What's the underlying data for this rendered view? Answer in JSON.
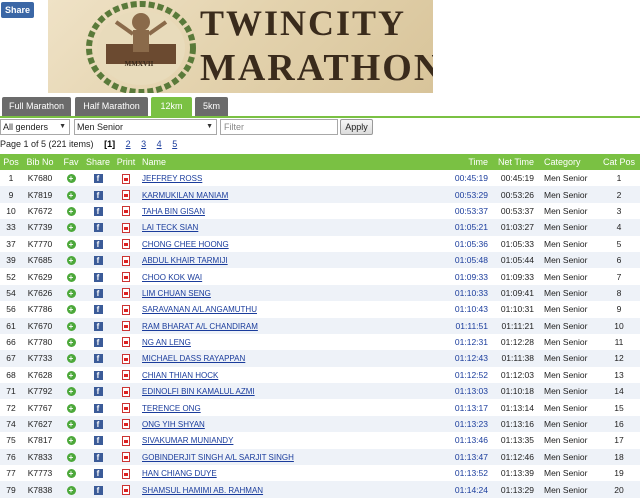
{
  "share_label": "Share",
  "banner": {
    "emblem_text": "MMXVII",
    "title_line1": "TWINCITY",
    "title_line2": "MARATHON"
  },
  "tabs": [
    {
      "label": "Full Marathon",
      "active": false
    },
    {
      "label": "Half Marathon",
      "active": false
    },
    {
      "label": "12km",
      "active": true
    },
    {
      "label": "5km",
      "active": false
    }
  ],
  "filters": {
    "gender_selected": "All genders",
    "category_selected": "Men Senior",
    "filter_placeholder": "Filter",
    "apply_label": "Apply"
  },
  "pager": {
    "summary": "Page 1 of 5 (221 items)",
    "current": "[1]",
    "pages": [
      "2",
      "3",
      "4",
      "5"
    ]
  },
  "columns": [
    "Pos",
    "Bib No",
    "Fav",
    "Share",
    "Print",
    "Name",
    "Time",
    "Net Time",
    "Category",
    "Cat Pos"
  ],
  "rows": [
    {
      "pos": "1",
      "bib": "K7680",
      "name": "JEFFREY ROSS",
      "time": "00:45:19",
      "net": "00:45:19",
      "cat": "Men Senior",
      "catpos": "1"
    },
    {
      "pos": "9",
      "bib": "K7819",
      "name": "KARMUKILAN MANIAM",
      "time": "00:53:29",
      "net": "00:53:26",
      "cat": "Men Senior",
      "catpos": "2"
    },
    {
      "pos": "10",
      "bib": "K7672",
      "name": "TAHA BIN GISAN",
      "time": "00:53:37",
      "net": "00:53:37",
      "cat": "Men Senior",
      "catpos": "3"
    },
    {
      "pos": "33",
      "bib": "K7739",
      "name": "LAI TECK SIAN",
      "time": "01:05:21",
      "net": "01:03:27",
      "cat": "Men Senior",
      "catpos": "4"
    },
    {
      "pos": "37",
      "bib": "K7770",
      "name": "CHONG CHEE HOONG",
      "time": "01:05:36",
      "net": "01:05:33",
      "cat": "Men Senior",
      "catpos": "5"
    },
    {
      "pos": "39",
      "bib": "K7685",
      "name": "ABDUL KHAIR TARMIJI",
      "time": "01:05:48",
      "net": "01:05:44",
      "cat": "Men Senior",
      "catpos": "6"
    },
    {
      "pos": "52",
      "bib": "K7629",
      "name": "CHOO KOK WAI",
      "time": "01:09:33",
      "net": "01:09:33",
      "cat": "Men Senior",
      "catpos": "7"
    },
    {
      "pos": "54",
      "bib": "K7626",
      "name": "LIM CHUAN SENG",
      "time": "01:10:33",
      "net": "01:09:41",
      "cat": "Men Senior",
      "catpos": "8"
    },
    {
      "pos": "56",
      "bib": "K7786",
      "name": "SARAVANAN A/L ANGAMUTHU",
      "time": "01:10:43",
      "net": "01:10:31",
      "cat": "Men Senior",
      "catpos": "9"
    },
    {
      "pos": "61",
      "bib": "K7670",
      "name": "RAM BHARAT A/L CHANDIRAM",
      "time": "01:11:51",
      "net": "01:11:21",
      "cat": "Men Senior",
      "catpos": "10"
    },
    {
      "pos": "66",
      "bib": "K7780",
      "name": "NG AN LENG",
      "time": "01:12:31",
      "net": "01:12:28",
      "cat": "Men Senior",
      "catpos": "11"
    },
    {
      "pos": "67",
      "bib": "K7733",
      "name": "MICHAEL DASS RAYAPPAN",
      "time": "01:12:43",
      "net": "01:11:38",
      "cat": "Men Senior",
      "catpos": "12"
    },
    {
      "pos": "68",
      "bib": "K7628",
      "name": "CHIAN THIAN HOCK",
      "time": "01:12:52",
      "net": "01:12:03",
      "cat": "Men Senior",
      "catpos": "13"
    },
    {
      "pos": "71",
      "bib": "K7792",
      "name": "EDINOLFI BIN KAMALUL AZMI",
      "time": "01:13:03",
      "net": "01:10:18",
      "cat": "Men Senior",
      "catpos": "14"
    },
    {
      "pos": "72",
      "bib": "K7767",
      "name": "TERENCE ONG",
      "time": "01:13:17",
      "net": "01:13:14",
      "cat": "Men Senior",
      "catpos": "15"
    },
    {
      "pos": "74",
      "bib": "K7627",
      "name": "ONG YIH SHYAN",
      "time": "01:13:23",
      "net": "01:13:16",
      "cat": "Men Senior",
      "catpos": "16"
    },
    {
      "pos": "75",
      "bib": "K7817",
      "name": "SIVAKUMAR MUNIANDY",
      "time": "01:13:46",
      "net": "01:13:35",
      "cat": "Men Senior",
      "catpos": "17"
    },
    {
      "pos": "76",
      "bib": "K7833",
      "name": "GOBINDERJIT SINGH A/L SARJIT SINGH",
      "time": "01:13:47",
      "net": "01:12:46",
      "cat": "Men Senior",
      "catpos": "18"
    },
    {
      "pos": "77",
      "bib": "K7773",
      "name": "HAN CHIANG DUYE",
      "time": "01:13:52",
      "net": "01:13:39",
      "cat": "Men Senior",
      "catpos": "19"
    },
    {
      "pos": "79",
      "bib": "K7838",
      "name": "SHAMSUL HAMIMI AB. RAHMAN",
      "time": "01:14:24",
      "net": "01:13:29",
      "cat": "Men Senior",
      "catpos": "20"
    }
  ],
  "colors": {
    "accent": "#7ac143",
    "tab_inactive": "#6b6b6b",
    "link": "#1a3c9c",
    "share": "#3b67a6"
  }
}
